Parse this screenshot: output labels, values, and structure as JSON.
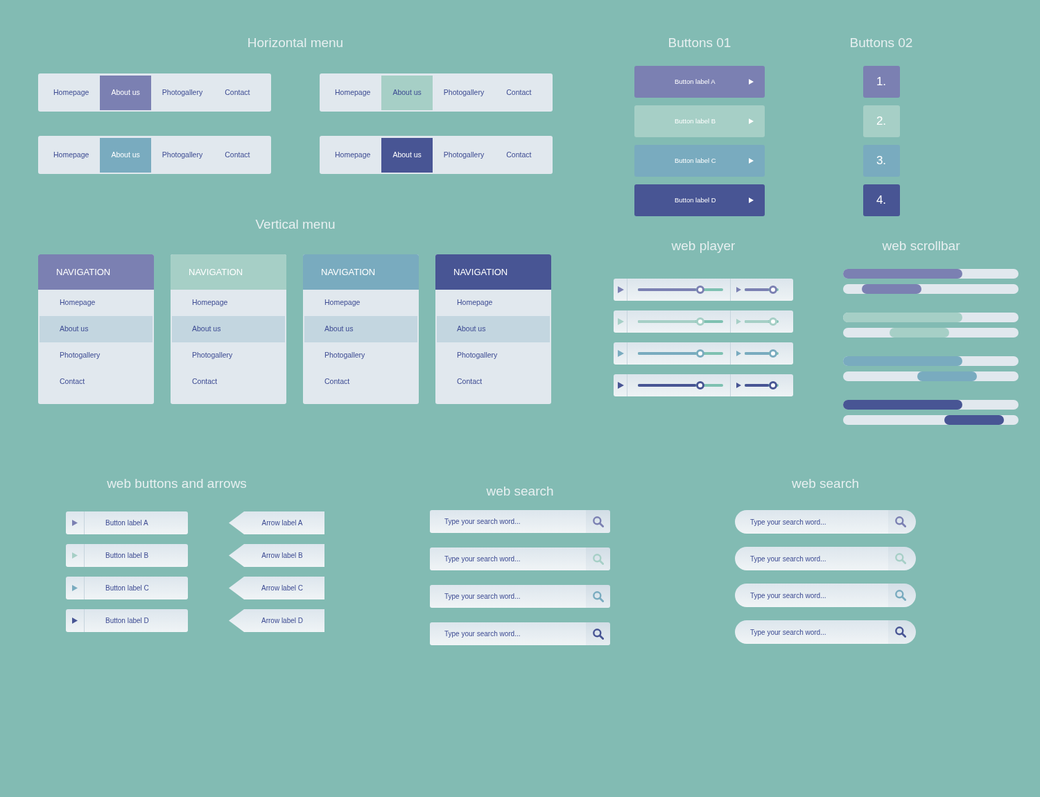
{
  "horizontal_menu": {
    "title": "Horizontal menu",
    "menus": [
      {
        "color": "#7b80b2",
        "items": [
          {
            "label": "Homepage",
            "selected": false
          },
          {
            "label": "About us",
            "selected": true
          },
          {
            "label": "Photogallery",
            "selected": false
          },
          {
            "label": "Contact",
            "selected": false
          }
        ]
      },
      {
        "color": "#a6cfc6",
        "items": [
          {
            "label": "Homepage",
            "selected": false
          },
          {
            "label": "About us",
            "selected": true
          },
          {
            "label": "Photogallery",
            "selected": false
          },
          {
            "label": "Contact",
            "selected": false
          }
        ]
      },
      {
        "color": "#79abbf",
        "items": [
          {
            "label": "Homepage",
            "selected": false
          },
          {
            "label": "About us",
            "selected": true
          },
          {
            "label": "Photogallery",
            "selected": false
          },
          {
            "label": "Contact",
            "selected": false
          }
        ]
      },
      {
        "color": "#485594",
        "items": [
          {
            "label": "Homepage",
            "selected": false
          },
          {
            "label": "About us",
            "selected": true
          },
          {
            "label": "Photogallery",
            "selected": false
          },
          {
            "label": "Contact",
            "selected": false
          }
        ]
      }
    ]
  },
  "vertical_menu": {
    "title": "Vertical menu",
    "menus": [
      {
        "color": "#7b80b2",
        "heading": "NAVIGATION",
        "items": [
          {
            "label": "Homepage",
            "selected": false
          },
          {
            "label": "About us",
            "selected": true
          },
          {
            "label": "Photogallery",
            "selected": false
          },
          {
            "label": "Contact",
            "selected": false
          }
        ]
      },
      {
        "color": "#a6cfc6",
        "heading": "NAVIGATION",
        "items": [
          {
            "label": "Homepage",
            "selected": false
          },
          {
            "label": "About us",
            "selected": true
          },
          {
            "label": "Photogallery",
            "selected": false
          },
          {
            "label": "Contact",
            "selected": false
          }
        ]
      },
      {
        "color": "#79abbf",
        "heading": "NAVIGATION",
        "items": [
          {
            "label": "Homepage",
            "selected": false
          },
          {
            "label": "About us",
            "selected": true
          },
          {
            "label": "Photogallery",
            "selected": false
          },
          {
            "label": "Contact",
            "selected": false
          }
        ]
      },
      {
        "color": "#485594",
        "heading": "NAVIGATION",
        "items": [
          {
            "label": "Homepage",
            "selected": false
          },
          {
            "label": "About us",
            "selected": true
          },
          {
            "label": "Photogallery",
            "selected": false
          },
          {
            "label": "Contact",
            "selected": false
          }
        ]
      }
    ]
  },
  "buttons_01": {
    "title": "Buttons 01",
    "buttons": [
      {
        "label": "Button label A",
        "color": "#7b80b2"
      },
      {
        "label": "Button label B",
        "color": "#a6cfc6"
      },
      {
        "label": "Button label C",
        "color": "#79abbf"
      },
      {
        "label": "Button label D",
        "color": "#485594"
      }
    ]
  },
  "buttons_02": {
    "title": "Buttons 02",
    "buttons": [
      {
        "label": "1.",
        "color": "#7b80b2"
      },
      {
        "label": "2.",
        "color": "#a6cfc6"
      },
      {
        "label": "3.",
        "color": "#79abbf"
      },
      {
        "label": "4.",
        "color": "#485594"
      }
    ]
  },
  "web_player": {
    "title": "web player",
    "players": [
      {
        "color": "#7b80b2",
        "seek": {
          "level": 0.68
        },
        "volume": {
          "level": 0.72
        }
      },
      {
        "color": "#a6cfc6",
        "seek": {
          "level": 0.68
        },
        "volume": {
          "level": 0.72
        }
      },
      {
        "color": "#79abbf",
        "seek": {
          "level": 0.68
        },
        "volume": {
          "level": 0.72
        }
      },
      {
        "color": "#485594",
        "seek": {
          "level": 0.68
        },
        "volume": {
          "level": 0.72
        }
      }
    ]
  },
  "web_scrollbar": {
    "title": "web scrollbar",
    "scrollbars": [
      {
        "color": "#7b80b2"
      },
      {
        "color": "#a6cfc6"
      },
      {
        "color": "#79abbf"
      },
      {
        "color": "#485594"
      }
    ]
  },
  "web_buttons_and_arrows": {
    "title": "web buttons and arrows",
    "buttons": [
      {
        "label": "Button label A",
        "color": "#7b80b2"
      },
      {
        "label": "Button label B",
        "color": "#a6cfc6"
      },
      {
        "label": "Button label C",
        "color": "#79abbf"
      },
      {
        "label": "Button label D",
        "color": "#485594"
      }
    ],
    "arrows": [
      {
        "label": "Arrow label A"
      },
      {
        "label": "Arrow label B"
      },
      {
        "label": "Arrow label C"
      },
      {
        "label": "Arrow label D"
      }
    ]
  },
  "web_search": {
    "title": "web search",
    "fields": [
      {
        "placeholder": "Type your search word...",
        "color": "#7b80b2"
      },
      {
        "placeholder": "Type your search word...",
        "color": "#a6cfc6"
      },
      {
        "placeholder": "Type your search word...",
        "color": "#79abbf"
      },
      {
        "placeholder": "Type your search word...",
        "color": "#485594"
      }
    ]
  },
  "web_search_rounded": {
    "title": "web search",
    "fields": [
      {
        "placeholder": "Type your search word...",
        "color": "#7b80b2"
      },
      {
        "placeholder": "Type your search word...",
        "color": "#a6cfc6"
      },
      {
        "placeholder": "Type your search word...",
        "color": "#79abbf"
      },
      {
        "placeholder": "Type your search word...",
        "color": "#485594"
      }
    ]
  }
}
